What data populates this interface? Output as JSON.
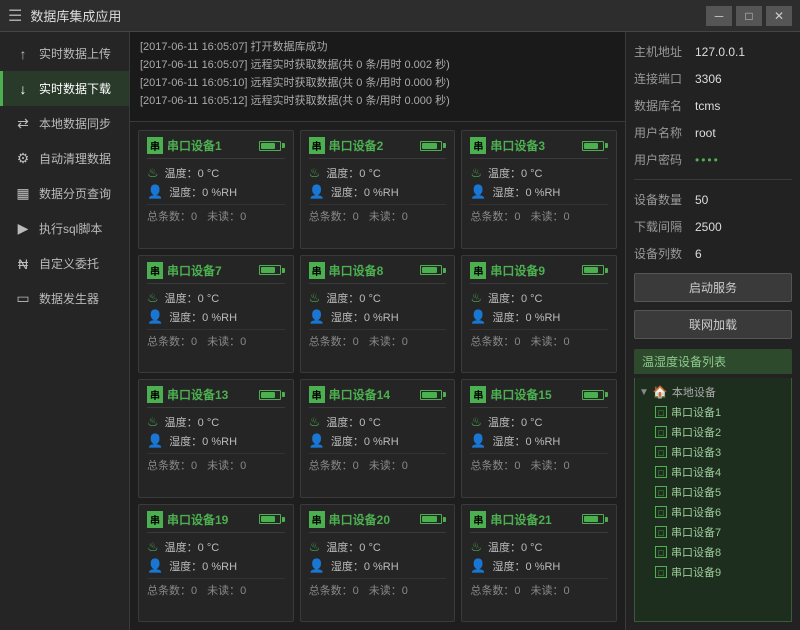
{
  "titleBar": {
    "icon": "☰",
    "title": "数据库集成应用",
    "minBtn": "─",
    "maxBtn": "□",
    "closeBtn": "✕"
  },
  "sidebar": {
    "items": [
      {
        "id": "upload",
        "icon": "↑",
        "label": "实时数据上传"
      },
      {
        "id": "download",
        "icon": "↓",
        "label": "实时数据下载",
        "active": true
      },
      {
        "id": "sync",
        "icon": "⇄",
        "label": "本地数据同步"
      },
      {
        "id": "auto",
        "icon": "⚙",
        "label": "自动清理数据"
      },
      {
        "id": "query",
        "icon": "▦",
        "label": "数据分页查询"
      },
      {
        "id": "sql",
        "icon": "▶",
        "label": "执行sql脚本"
      },
      {
        "id": "delegate",
        "icon": "₦",
        "label": "自定义委托"
      },
      {
        "id": "generator",
        "icon": "▭",
        "label": "数据发生器"
      }
    ]
  },
  "logs": [
    "[2017-06-11 16:05:07] 打开数据库成功",
    "[2017-06-11 16:05:07] 远程实时获取数据(共 0 条/用时 0.002 秒)",
    "[2017-06-11 16:05:10] 远程实时获取数据(共 0 条/用时 0.000 秒)",
    "[2017-06-11 16:05:12] 远程实时获取数据(共 0 条/用时 0.000 秒)"
  ],
  "devices": [
    {
      "id": 1,
      "name": "串口设备1",
      "temp": "0 °C",
      "humidity": "0 %RH",
      "total": "0",
      "unread": "0"
    },
    {
      "id": 2,
      "name": "串口设备2",
      "temp": "0 °C",
      "humidity": "0 %RH",
      "total": "0",
      "unread": "0"
    },
    {
      "id": 3,
      "name": "串口设备3",
      "temp": "0 °C",
      "humidity": "0 %RH",
      "total": "0",
      "unread": "0"
    },
    {
      "id": 7,
      "name": "串口设备7",
      "temp": "0 °C",
      "humidity": "0 %RH",
      "total": "0",
      "unread": "0"
    },
    {
      "id": 8,
      "name": "串口设备8",
      "temp": "0 °C",
      "humidity": "0 %RH",
      "total": "0",
      "unread": "0"
    },
    {
      "id": 9,
      "name": "串口设备9",
      "temp": "0 °C",
      "humidity": "0 %RH",
      "total": "0",
      "unread": "0"
    },
    {
      "id": 13,
      "name": "串口设备13",
      "temp": "0 °C",
      "humidity": "0 %RH",
      "total": "0",
      "unread": "0"
    },
    {
      "id": 14,
      "name": "串口设备14",
      "temp": "0 °C",
      "humidity": "0 %RH",
      "total": "0",
      "unread": "0"
    },
    {
      "id": 15,
      "name": "串口设备15",
      "temp": "0 °C",
      "humidity": "0 %RH",
      "total": "0",
      "unread": "0"
    },
    {
      "id": 19,
      "name": "串口设备19",
      "temp": "0 °C",
      "humidity": "0 %RH",
      "total": "0",
      "unread": "0"
    },
    {
      "id": 20,
      "name": "串口设备20",
      "temp": "0 °C",
      "humidity": "0 %RH",
      "total": "0",
      "unread": "0"
    },
    {
      "id": 21,
      "name": "串口设备21",
      "temp": "0 °C",
      "humidity": "0 %RH",
      "total": "0",
      "unread": "0"
    }
  ],
  "rightPanel": {
    "hostLabel": "主机地址",
    "hostValue": "127.0.0.1",
    "portLabel": "连接端口",
    "portValue": "3306",
    "dbLabel": "数据库名",
    "dbValue": "tcms",
    "userLabel": "用户名称",
    "userValue": "root",
    "passLabel": "用户密码",
    "passValue": "••••",
    "countLabel": "设备数量",
    "countValue": "50",
    "intervalLabel": "下载间隔",
    "intervalValue": "2500",
    "columnsLabel": "设备列数",
    "columnsValue": "6",
    "startBtn": "启动服务",
    "networkBtn": "联网加载",
    "treeHeader": "温湿度设备列表",
    "localGroup": "本地设备",
    "treeItems": [
      "串口设备1",
      "串口设备2",
      "串口设备3",
      "串口设备4",
      "串口设备5",
      "串口设备6",
      "串口设备7",
      "串口设备8",
      "串口设备9"
    ]
  },
  "labels": {
    "tempPrefix": "温度：",
    "humidPrefix": "湿度：",
    "totalPrefix": "总条数：",
    "unreadPrefix": "未读："
  }
}
